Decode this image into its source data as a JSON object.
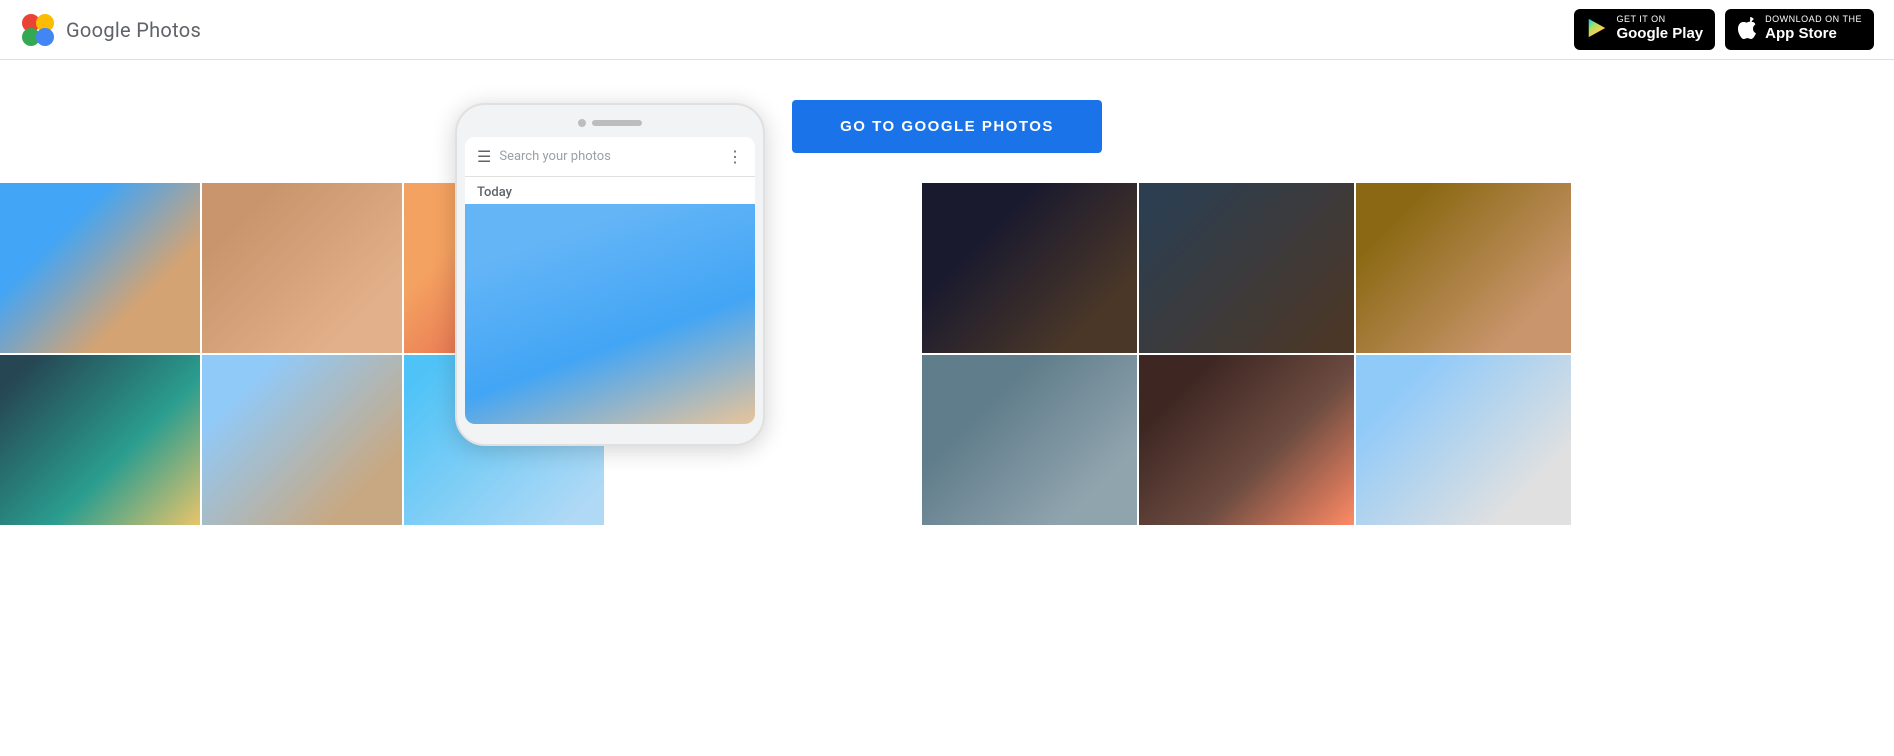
{
  "header": {
    "logo_text": "Google Photos",
    "google_play": {
      "get_it_on": "GET IT ON",
      "label": "Google Play",
      "icon": "▶"
    },
    "app_store": {
      "download_on": "Download on the",
      "label": "App Store",
      "icon": ""
    }
  },
  "cta": {
    "button_label": "GO TO GOOGLE PHOTOS"
  },
  "phone": {
    "search_placeholder": "Search your photos",
    "today_label": "Today"
  }
}
